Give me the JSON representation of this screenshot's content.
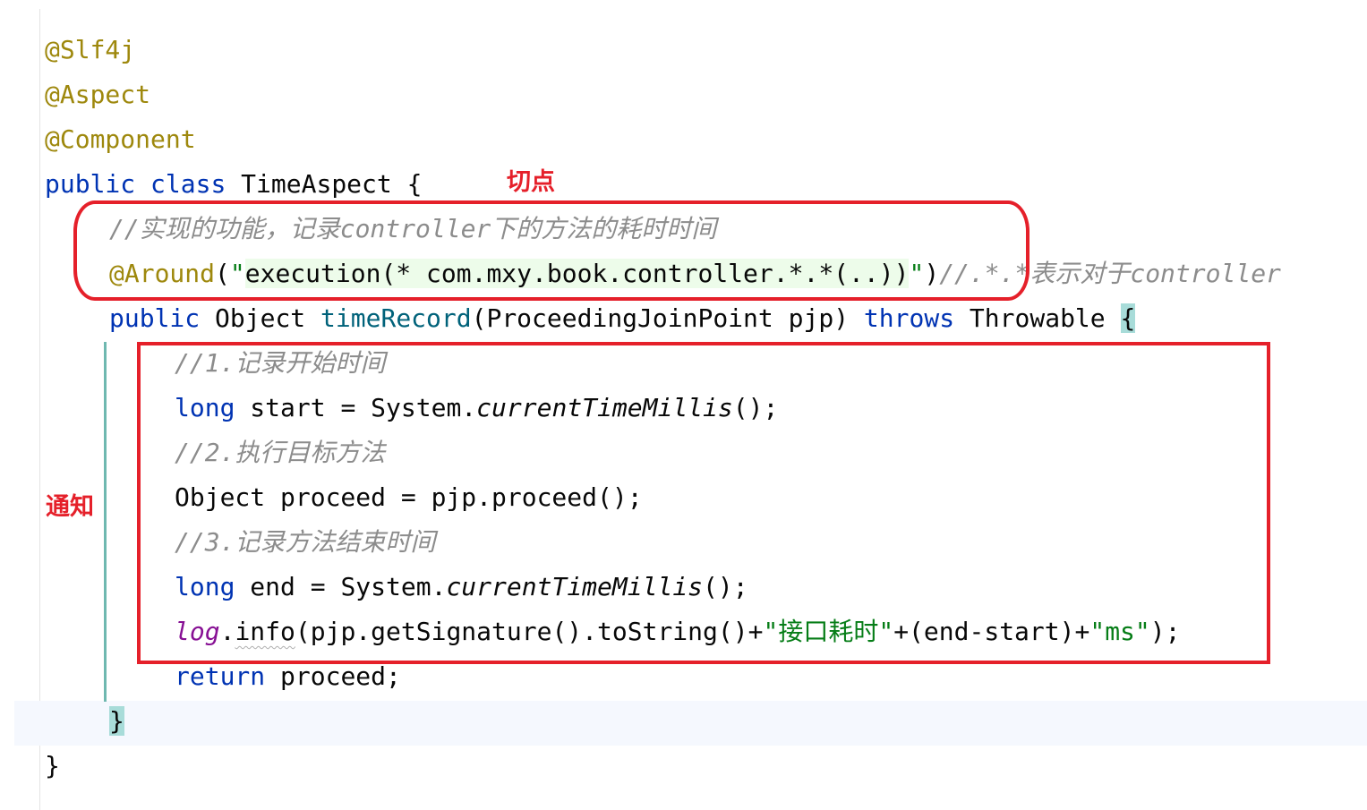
{
  "code": {
    "l1": {
      "annotation": "@Slf4j"
    },
    "l2": {
      "annotation": "@Aspect"
    },
    "l3": {
      "annotation": "@Component"
    },
    "l4": {
      "kw_public": "public",
      "kw_class": "class",
      "class_name": "TimeAspect",
      "brace": "{"
    },
    "l5": {
      "comment": "//实现的功能，记录controller下的方法的耗时时间"
    },
    "l6": {
      "annotation": "@Around",
      "paren_open": "(",
      "quote_open": "\"",
      "pointcut_expr": "execution(* com.mxy.book.controller.*.*(..))",
      "quote_close": "\"",
      "paren_close": ")",
      "comment": "//.*.*表示对于controller"
    },
    "l7": {
      "kw_public": "public",
      "return_type": "Object",
      "method_name": "timeRecord",
      "params": "(ProceedingJoinPoint pjp)",
      "kw_throws": "throws",
      "exception": "Throwable",
      "brace": "{"
    },
    "l8": {
      "comment": "//1.记录开始时间"
    },
    "l9": {
      "kw_long": "long",
      "text": "start = System.",
      "static_call": "currentTimeMillis",
      "tail": "();"
    },
    "l10": {
      "comment": "//2.执行目标方法"
    },
    "l11": {
      "text": "Object proceed = pjp.proceed();"
    },
    "l12": {
      "comment": "//3.记录方法结束时间"
    },
    "l13": {
      "kw_long": "long",
      "text": "end = System.",
      "static_call": "currentTimeMillis",
      "tail": "();"
    },
    "l14": {
      "field": "log",
      "dot": ".",
      "call": "info",
      "mid": "(pjp.getSignature().toString()+",
      "str1": "\"接口耗时\"",
      "mid2": "+(end-start)+",
      "str2": "\"ms\"",
      "tail": ");"
    },
    "l15": {
      "kw_return": "return",
      "text": "proceed;"
    },
    "l16": {
      "brace": "}"
    },
    "l17": {
      "brace": "}"
    }
  },
  "annotations": {
    "pointcut_label": "切点",
    "advice_label": "通知",
    "box_color": "#e5202a"
  }
}
